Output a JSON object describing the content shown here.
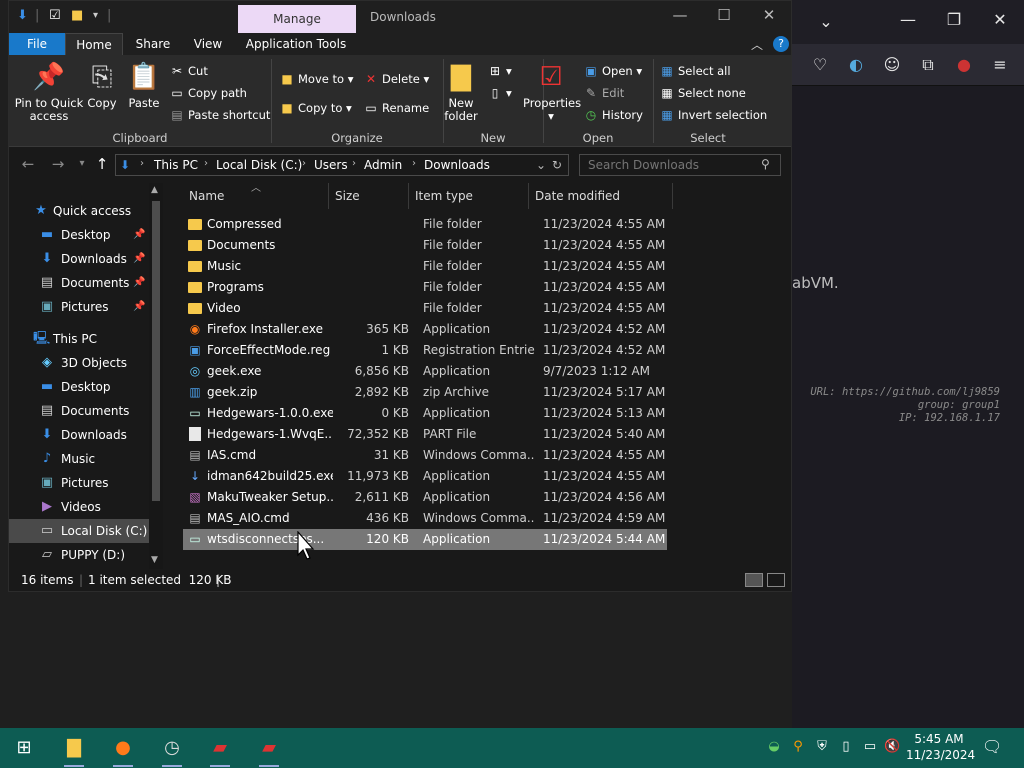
{
  "browser": {
    "background_text": "abVM.",
    "info_lines": [
      "URL: https://github.com/lj9859",
      "group: group1",
      "IP: 192.168.1.17"
    ]
  },
  "explorer": {
    "title": "Downloads",
    "contextual_tab": "Manage",
    "tabs": [
      "File",
      "Home",
      "Share",
      "View",
      "Application Tools"
    ],
    "ribbon": {
      "clipboard": {
        "label": "Clipboard",
        "pin": "Pin to Quick access",
        "pin_line1": "Pin to Quick",
        "pin_line2": "access",
        "copy": "Copy",
        "paste": "Paste",
        "cut": "Cut",
        "copy_path": "Copy path",
        "paste_shortcut": "Paste shortcut"
      },
      "organize": {
        "label": "Organize",
        "move_to": "Move to",
        "copy_to": "Copy to",
        "delete": "Delete",
        "rename": "Rename"
      },
      "new": {
        "label": "New",
        "new_folder_line1": "New",
        "new_folder_line2": "folder"
      },
      "open": {
        "label": "Open",
        "properties": "Properties",
        "open": "Open",
        "edit": "Edit",
        "history": "History"
      },
      "select": {
        "label": "Select",
        "select_all": "Select all",
        "select_none": "Select none",
        "invert": "Invert selection"
      }
    },
    "breadcrumb": [
      "This PC",
      "Local Disk (C:)",
      "Users",
      "Admin",
      "Downloads"
    ],
    "search_placeholder": "Search Downloads",
    "nav": {
      "quick_access": "Quick access",
      "quick_items": [
        "Desktop",
        "Downloads",
        "Documents",
        "Pictures"
      ],
      "this_pc": "This PC",
      "pc_items": [
        "3D Objects",
        "Desktop",
        "Documents",
        "Downloads",
        "Music",
        "Pictures",
        "Videos",
        "Local Disk (C:)",
        "PUPPY (D:)"
      ]
    },
    "columns": [
      "Name",
      "Size",
      "Item type",
      "Date modified"
    ],
    "files": [
      {
        "name": "Compressed",
        "size": "",
        "type": "File folder",
        "date": "11/23/2024 4:55 AM",
        "icon": "folder"
      },
      {
        "name": "Documents",
        "size": "",
        "type": "File folder",
        "date": "11/23/2024 4:55 AM",
        "icon": "folder"
      },
      {
        "name": "Music",
        "size": "",
        "type": "File folder",
        "date": "11/23/2024 4:55 AM",
        "icon": "folder"
      },
      {
        "name": "Programs",
        "size": "",
        "type": "File folder",
        "date": "11/23/2024 4:55 AM",
        "icon": "folder"
      },
      {
        "name": "Video",
        "size": "",
        "type": "File folder",
        "date": "11/23/2024 4:55 AM",
        "icon": "folder"
      },
      {
        "name": "Firefox Installer.exe",
        "size": "365 KB",
        "type": "Application",
        "date": "11/23/2024 4:52 AM",
        "icon": "firefox"
      },
      {
        "name": "ForceEffectMode.reg",
        "size": "1 KB",
        "type": "Registration Entries",
        "date": "11/23/2024 4:52 AM",
        "icon": "reg"
      },
      {
        "name": "geek.exe",
        "size": "6,856 KB",
        "type": "Application",
        "date": "9/7/2023 1:12 AM",
        "icon": "geek"
      },
      {
        "name": "geek.zip",
        "size": "2,892 KB",
        "type": "zip Archive",
        "date": "11/23/2024 5:17 AM",
        "icon": "zip"
      },
      {
        "name": "Hedgewars-1.0.0.exe",
        "size": "0 KB",
        "type": "Application",
        "date": "11/23/2024 5:13 AM",
        "icon": "app"
      },
      {
        "name": "Hedgewars-1.WvqE...",
        "size": "72,352 KB",
        "type": "PART File",
        "date": "11/23/2024 5:40 AM",
        "icon": "file"
      },
      {
        "name": "IAS.cmd",
        "size": "31 KB",
        "type": "Windows Comma...",
        "date": "11/23/2024 4:55 AM",
        "icon": "cmd"
      },
      {
        "name": "idman642build25.exe",
        "size": "11,973 KB",
        "type": "Application",
        "date": "11/23/2024 4:55 AM",
        "icon": "idm"
      },
      {
        "name": "MakuTweaker Setup...",
        "size": "2,611 KB",
        "type": "Application",
        "date": "11/23/2024 4:56 AM",
        "icon": "maku"
      },
      {
        "name": "MAS_AIO.cmd",
        "size": "436 KB",
        "type": "Windows Comma...",
        "date": "11/23/2024 4:59 AM",
        "icon": "cmd"
      },
      {
        "name": "wtsdisconnectses...",
        "size": "120 KB",
        "type": "Application",
        "date": "11/23/2024 5:44 AM",
        "icon": "app",
        "selected": true
      }
    ],
    "status": {
      "items": "16 items",
      "selected": "1 item selected  120 KB"
    }
  },
  "taskbar": {
    "time": "5:45 AM",
    "date": "11/23/2024"
  }
}
